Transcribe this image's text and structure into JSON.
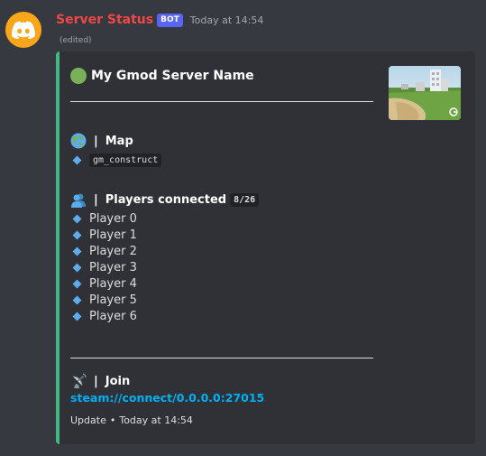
{
  "header": {
    "username": "Server Status",
    "bot_tag": "BOT",
    "timestamp": "Today at 14:54",
    "edited": "(edited)"
  },
  "colors": {
    "embed_accent": "#43b581",
    "username": "#f04747",
    "link": "#00b0f4",
    "avatar_bg": "#faa61a"
  },
  "embed": {
    "title": "My Gmod Server Name",
    "status_icon": "green-circle-icon",
    "map": {
      "name": "Map",
      "icon": "globe-icon",
      "value": "gm_construct"
    },
    "players": {
      "name": "Players connected",
      "icon": "busts-icon",
      "count": "8/26",
      "list": [
        "Player 0",
        "Player 1",
        "Player 2",
        "Player 3",
        "Player 4",
        "Player 5",
        "Player 6"
      ]
    },
    "join": {
      "name": "Join",
      "icon": "satellite-antenna-icon",
      "link": "steam://connect/0.0.0.0:27015"
    },
    "footer": {
      "text": "Update",
      "separator": "•",
      "timestamp": "Today at 14:54"
    }
  }
}
